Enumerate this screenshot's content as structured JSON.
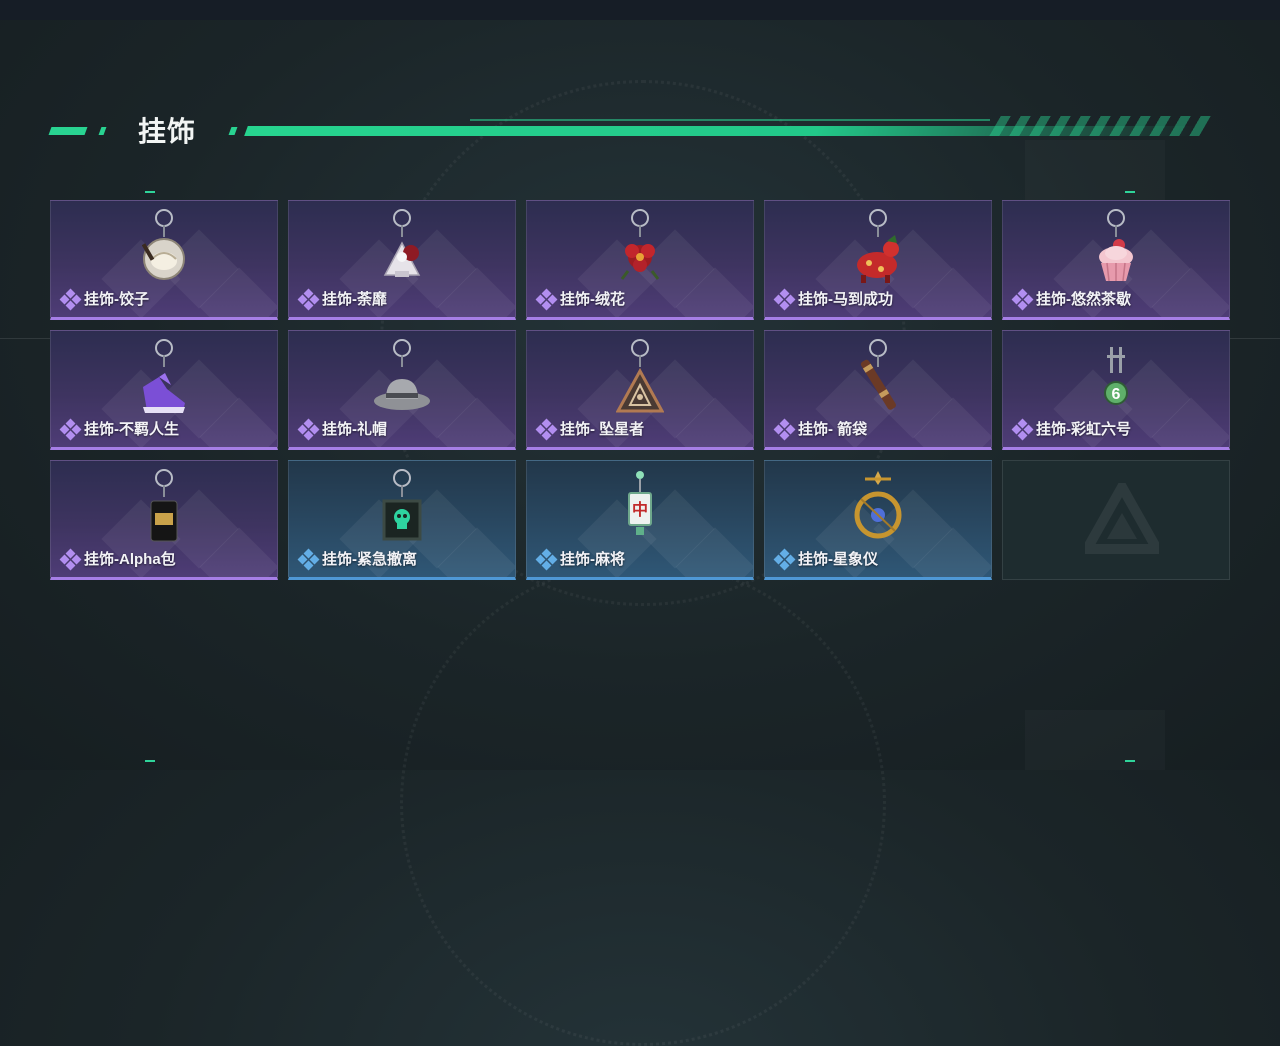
{
  "header": {
    "title": "挂饰"
  },
  "colors": {
    "accent": "#29d391",
    "purple_rarity": "#a67ee6",
    "blue_rarity": "#4f98d6"
  },
  "items": [
    {
      "label": "挂饰-饺子",
      "rarity": "purple",
      "icon": "dumpling-charm-icon"
    },
    {
      "label": "挂饰-荼靡",
      "rarity": "purple",
      "icon": "flower-doll-charm-icon"
    },
    {
      "label": "挂饰-绒花",
      "rarity": "purple",
      "icon": "red-flower-charm-icon"
    },
    {
      "label": "挂饰-马到成功",
      "rarity": "purple",
      "icon": "horse-charm-icon"
    },
    {
      "label": "挂饰-悠然茶歇",
      "rarity": "purple",
      "icon": "cupcake-charm-icon"
    },
    {
      "label": "挂饰-不羁人生",
      "rarity": "purple",
      "icon": "sneaker-charm-icon"
    },
    {
      "label": "挂饰-礼帽",
      "rarity": "purple",
      "icon": "hat-charm-icon"
    },
    {
      "label": "挂饰- 坠星者",
      "rarity": "purple",
      "icon": "triangle-emblem-charm-icon"
    },
    {
      "label": "挂饰- 箭袋",
      "rarity": "purple",
      "icon": "quiver-charm-icon"
    },
    {
      "label": "挂饰-彩虹六号",
      "rarity": "purple",
      "icon": "rainbow-six-charm-icon"
    },
    {
      "label": "挂饰-Alpha包",
      "rarity": "purple",
      "icon": "alpha-bag-charm-icon"
    },
    {
      "label": "挂饰-紧急撤离",
      "rarity": "blue",
      "icon": "evac-skull-charm-icon"
    },
    {
      "label": "挂饰-麻将",
      "rarity": "blue",
      "icon": "mahjong-tile-charm-icon"
    },
    {
      "label": "挂饰-星象仪",
      "rarity": "blue",
      "icon": "astrolabe-charm-icon"
    }
  ]
}
